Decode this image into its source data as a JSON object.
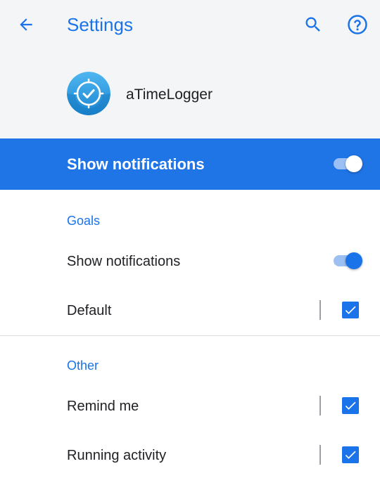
{
  "app_bar": {
    "title": "Settings",
    "back_icon": "arrow-back-icon",
    "search_icon": "search-icon",
    "help_icon": "help-circle-icon"
  },
  "app": {
    "name": "aTimeLogger",
    "icon": "clock-check-app-icon"
  },
  "master_toggle": {
    "label": "Show notifications",
    "on": true
  },
  "sections": {
    "goals": {
      "header": "Goals",
      "show_notifications": {
        "label": "Show notifications",
        "on": true
      },
      "default": {
        "label": "Default",
        "checked": true
      }
    },
    "other": {
      "header": "Other",
      "remind_me": {
        "label": "Remind me",
        "checked": true
      },
      "running_activity": {
        "label": "Running activity",
        "checked": true
      }
    }
  },
  "colors": {
    "accent": "#1a73e8",
    "master_bar": "#1f74e6",
    "header_bg": "#f4f5f7",
    "text_primary": "#202124"
  }
}
